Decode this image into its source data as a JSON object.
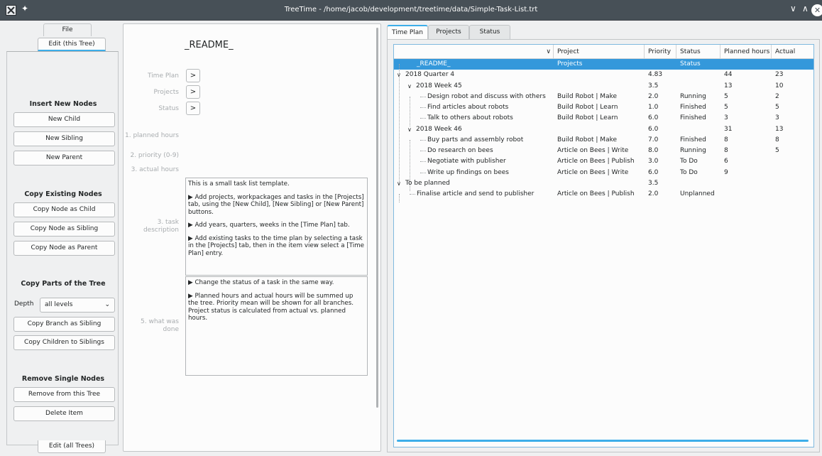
{
  "window": {
    "title": "TreeTime - /home/jacob/development/treetime/data/Simple-Task-List.trt",
    "controls": {
      "minimize": "∨",
      "maximize": "∧",
      "close": "✕"
    }
  },
  "left_panel": {
    "tab_file": "File",
    "tab_edit_tree": "Edit (this Tree)",
    "tab_edit_all": "Edit (all Trees)",
    "insert_title": "Insert New Nodes",
    "new_child": "New Child",
    "new_sibling": "New Sibling",
    "new_parent": "New Parent",
    "copy_title": "Copy Existing Nodes",
    "copy_as_child": "Copy Node as Child",
    "copy_as_sibling": "Copy Node as Sibling",
    "copy_as_parent": "Copy Node as Parent",
    "parts_title": "Copy Parts of the Tree",
    "depth_label": "Depth",
    "depth_value": "all levels",
    "copy_branch": "Copy Branch as Sibling",
    "copy_children": "Copy Children to Siblings",
    "remove_title": "Remove Single Nodes",
    "remove_from_tree": "Remove from this Tree",
    "delete_item": "Delete Item"
  },
  "item_view": {
    "title": "_README_",
    "time_plan_label": "Time Plan",
    "projects_label": "Projects",
    "status_label": "Status",
    "nav_arrow": ">",
    "planned_hours_label": "1. planned hours",
    "priority_label": "2. priority (0-9)",
    "actual_hours_label": "3. actual hours",
    "task_description_label": "3. task description",
    "what_was_done_label": "5. what was done",
    "task_description": [
      "This is a small task list template.",
      "▶   Add projects, workpackages and tasks in the [Projects] tab, using the [New Child], [New Sibling] or [New Parent] buttons.",
      "▶   Add years, quarters, weeks in the [Time Plan] tab.",
      "▶   Add existing tasks to the time plan by selecting a task in the [Projects] tab, then in the item view select a [Time Plan] entry."
    ],
    "what_was_done": [
      "▶   Change the status of a task in the same way.",
      "▶   Planned hours and actual hours will be summed up the tree. Priority mean will be shown for all branches. Project status is calculated from actual vs. planned hours."
    ]
  },
  "right_panel": {
    "tabs": [
      "Time Plan",
      "Projects",
      "Status"
    ],
    "active_tab": "Time Plan",
    "columns": [
      "",
      "Project",
      "Priority",
      "Status",
      "Planned hours",
      "Actual hours"
    ],
    "rows": [
      {
        "name": "_README_",
        "project": "Projects",
        "priority": "",
        "status": "Status",
        "planned": "",
        "actual": "",
        "selected": true
      },
      {
        "name": "2018 Quarter 4",
        "project": "",
        "priority": "4.83",
        "status": "",
        "planned": "44",
        "actual": "23",
        "expander": "∨"
      },
      {
        "name": "2018 Week 45",
        "project": "",
        "priority": "3.5",
        "status": "",
        "planned": "13",
        "actual": "10",
        "expander": "∨"
      },
      {
        "name": "Design robot and discuss with others",
        "project": "Build Robot | Make",
        "priority": "2.0",
        "status": "Running",
        "planned": "5",
        "actual": "2"
      },
      {
        "name": "Find articles about robots",
        "project": "Build Robot | Learn",
        "priority": "1.0",
        "status": "Finished",
        "planned": "5",
        "actual": "5"
      },
      {
        "name": "Talk to others about robots",
        "project": "Build Robot | Learn",
        "priority": "6.0",
        "status": "Finished",
        "planned": "3",
        "actual": "3"
      },
      {
        "name": "2018 Week 46",
        "project": "",
        "priority": "6.0",
        "status": "",
        "planned": "31",
        "actual": "13",
        "expander": "∨"
      },
      {
        "name": "Buy parts and assembly robot",
        "project": "Build Robot | Make",
        "priority": "7.0",
        "status": "Finished",
        "planned": "8",
        "actual": "8"
      },
      {
        "name": "Do research on bees",
        "project": "Article on Bees | Write",
        "priority": "8.0",
        "status": "Running",
        "planned": "8",
        "actual": "5"
      },
      {
        "name": "Negotiate with publisher",
        "project": "Article on Bees | Publish",
        "priority": "3.0",
        "status": "To Do",
        "planned": "6",
        "actual": ""
      },
      {
        "name": "Write up findings on bees",
        "project": "Article on Bees | Write",
        "priority": "6.0",
        "status": "To Do",
        "planned": "9",
        "actual": ""
      },
      {
        "name": "To be planned",
        "project": "",
        "priority": "3.5",
        "status": "",
        "planned": "",
        "actual": "",
        "expander": "∨"
      },
      {
        "name": "Finalise article and send to publisher",
        "project": "Article on Bees | Publish",
        "priority": "2.0",
        "status": "Unplanned",
        "planned": "",
        "actual": ""
      }
    ],
    "name_col_chevron": "∨"
  },
  "colors": {
    "accent": "#3daee9",
    "selection": "#3498db",
    "titlebar": "#475057"
  }
}
